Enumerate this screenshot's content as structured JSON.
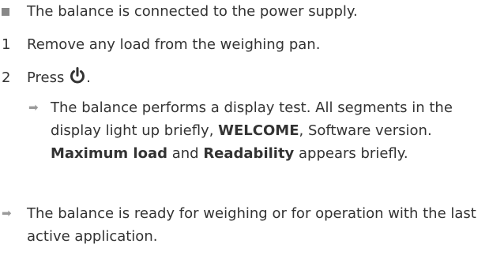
{
  "prerequisite": {
    "text": "The balance is connected to the power supply."
  },
  "steps": [
    {
      "number": "1",
      "text": "Remove any load from the weighing pan."
    },
    {
      "number": "2",
      "text_before": "Press ",
      "text_after": "."
    }
  ],
  "step2_result": {
    "part1": "The balance performs a display test. All segments in the display light up briefly, ",
    "bold1": "WELCOME",
    "part2": ", Software version. ",
    "bold2": "Maximum load",
    "part3": " and ",
    "bold3": "Readability",
    "part4": " appears briefly."
  },
  "final_result": {
    "text": "The balance is ready for weighing or for operation with the last active application."
  },
  "icons": {
    "prerequisite_marker": "square-bullet-icon",
    "result_marker": "arrow-right-icon",
    "power_button": "power-icon"
  },
  "colors": {
    "text": "#333333",
    "marker": "#888888",
    "arrow": "#9a9a9a"
  }
}
